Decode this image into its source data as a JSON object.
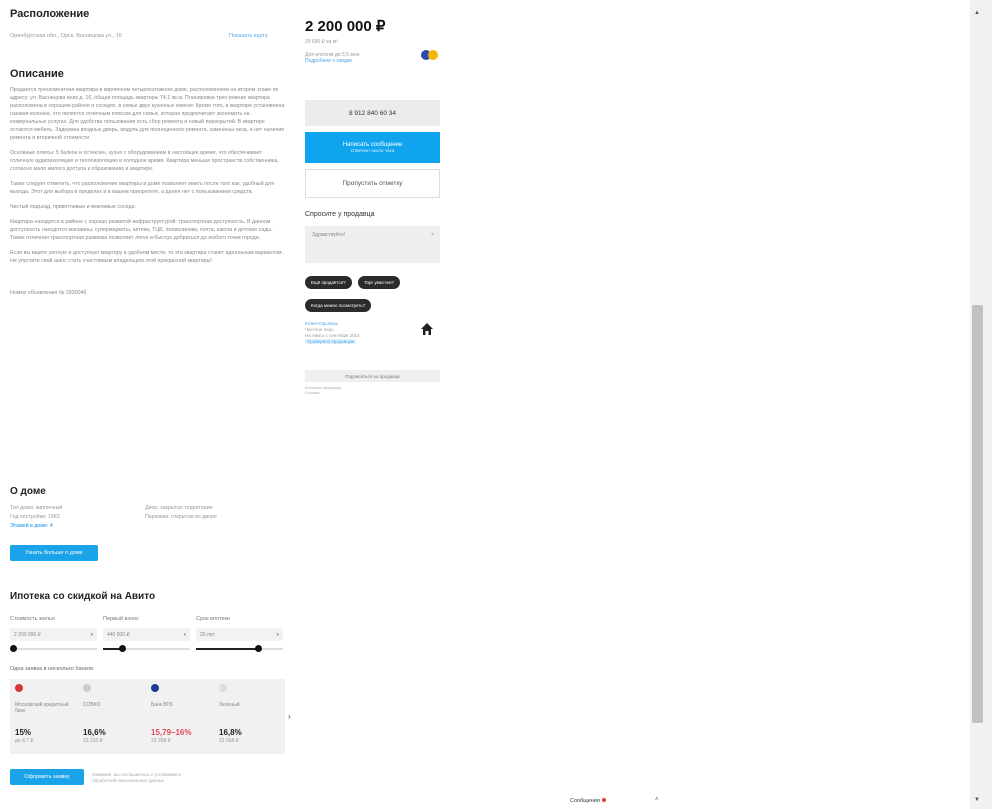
{
  "location": {
    "title": "Расположение",
    "address": "Оренбургская обл., Орск, Васнецова ул., 16",
    "map_link": "Показать карту"
  },
  "description": {
    "title": "Описание",
    "paragraphs": [
      "Продается трехкомнатная квартира в кирпичном четырехэтажном доме, расположенном на втором этаже по адресу: ул. Васнецова вниз д. 16, общая площадь квартиры 74,1 кв.м. Планировка трех-ровная квартира расположена в хорошем районе и соседях, в семье двух кухонных комнат. Кроме того, в квартире установлена газовая колонка, что является отличным плюсом для семьи, которая предпочитает экономить на коммунальных услугах. Для удобства пользования есть сбор ремонта и новый перекрытий. В квартире остаются мебель. Задержка входных дверь, модуль для полноценного ремонта, заменены окна, а нет наличие ремонта и вторичной стоимости.",
      "Основные плюсы: 5 балкон и остеклен, кухня с оборудованием в настоящее время, что обеспечивает отличную аудиоизоляцию и теплоизоляцию в холодное время. Квартира меньше пространств собственника, согласно мало жилого доступа к образованию и квартире.",
      "Также следует отметить, что расположение квартиры в доме позволяет иметь после того как, удобный для выхода. Этот для выбора в пределах и в вашем приоритете, а далее нет с пользованием средств.",
      "Чистый подъезд, приветливые и вежливые соседи.",
      "Квартира находится в районе с хорошо развитой инфраструктурой: транспортная доступность. В данном доступность находятся магазины, супермаркеты, аптеки, ТЦБ, поликлиники, почта, школа и детские сады. Также отличная транспортная развязка позволяет легко и быстро добраться до любого точки города.",
      "Если вы ищете уютную и доступную квартиру в удобном месте, то эта квартира станет идеальным вариантом. Не упустите свой шанс стать счастливым владельцем этой прекрасной квартиры!"
    ],
    "ad_number": "Номер объявления № 2930046"
  },
  "house": {
    "title": "О доме",
    "rows": [
      [
        "Тип дома: кирпичный",
        "Двор: закрытая территория"
      ],
      [
        "Год постройки: 1983",
        "Парковка: открытая во дворе"
      ],
      [
        "Этажей в доме: 4",
        ""
      ]
    ],
    "button": "Узнать больше о доме"
  },
  "mortgage": {
    "title": "Ипотека со скидкой на Авито",
    "labels": [
      "Стоимость жилья",
      "Первый взнос",
      "Срок ипотеки"
    ],
    "fields": [
      "2 200 000 ₽",
      "440 000 ₽",
      "20 лет"
    ],
    "banks_label": "Одна заявка в несколько банков",
    "banks": [
      {
        "name": "Московский кредитный банк",
        "rate": "15%",
        "pay": "до 8,7 ₽",
        "red": false,
        "color": "#d9343b"
      },
      {
        "name": "СОВКО",
        "rate": "16,6%",
        "pay": "23 310 ₽",
        "red": false,
        "color": "#cccccc"
      },
      {
        "name": "Банк ВТБ",
        "rate": "15,79–16%",
        "pay": "23 258 ₽",
        "red": true,
        "color": "#1b3e8f"
      },
      {
        "name": "Зеленый",
        "rate": "16,8%",
        "pay": "23 568 ₽",
        "red": false,
        "color": "#dddddd"
      }
    ],
    "apply_button": "Оформить заявку",
    "apply_note": "Нажимая, вы соглашаетесь с условиями и обработкой персональных данных"
  },
  "sidebar": {
    "price": "2 200 000 ₽",
    "price_sub": "29 690 ₽ за м²",
    "price_note": "Для ипотеки до 5,5 млн",
    "price_link": "Подробнее о скидке",
    "phone": "8 912 840 60 34",
    "message_button": "Написать сообщение",
    "message_sub": "Отвечает около часа",
    "review_button": "Пропустить отметку",
    "ask_title": "Спросите у продавца",
    "ask_placeholder": "Здравствуйте!",
    "chips": [
      "Ещё продаётся?",
      "Торг уместен?",
      "Когда можно посмотреть?"
    ],
    "seller_name": "Юлия Юрьевна",
    "seller_type": "Частное лицо",
    "seller_since": "На Авито с сентября 2014",
    "seller_badge": "Проверено продавцом",
    "subscribe": "Подписаться на продавца",
    "sub_note_1": "Контакты продавца",
    "sub_note_2": "Отзывы"
  },
  "footer": {
    "messages": "Сообщения"
  }
}
